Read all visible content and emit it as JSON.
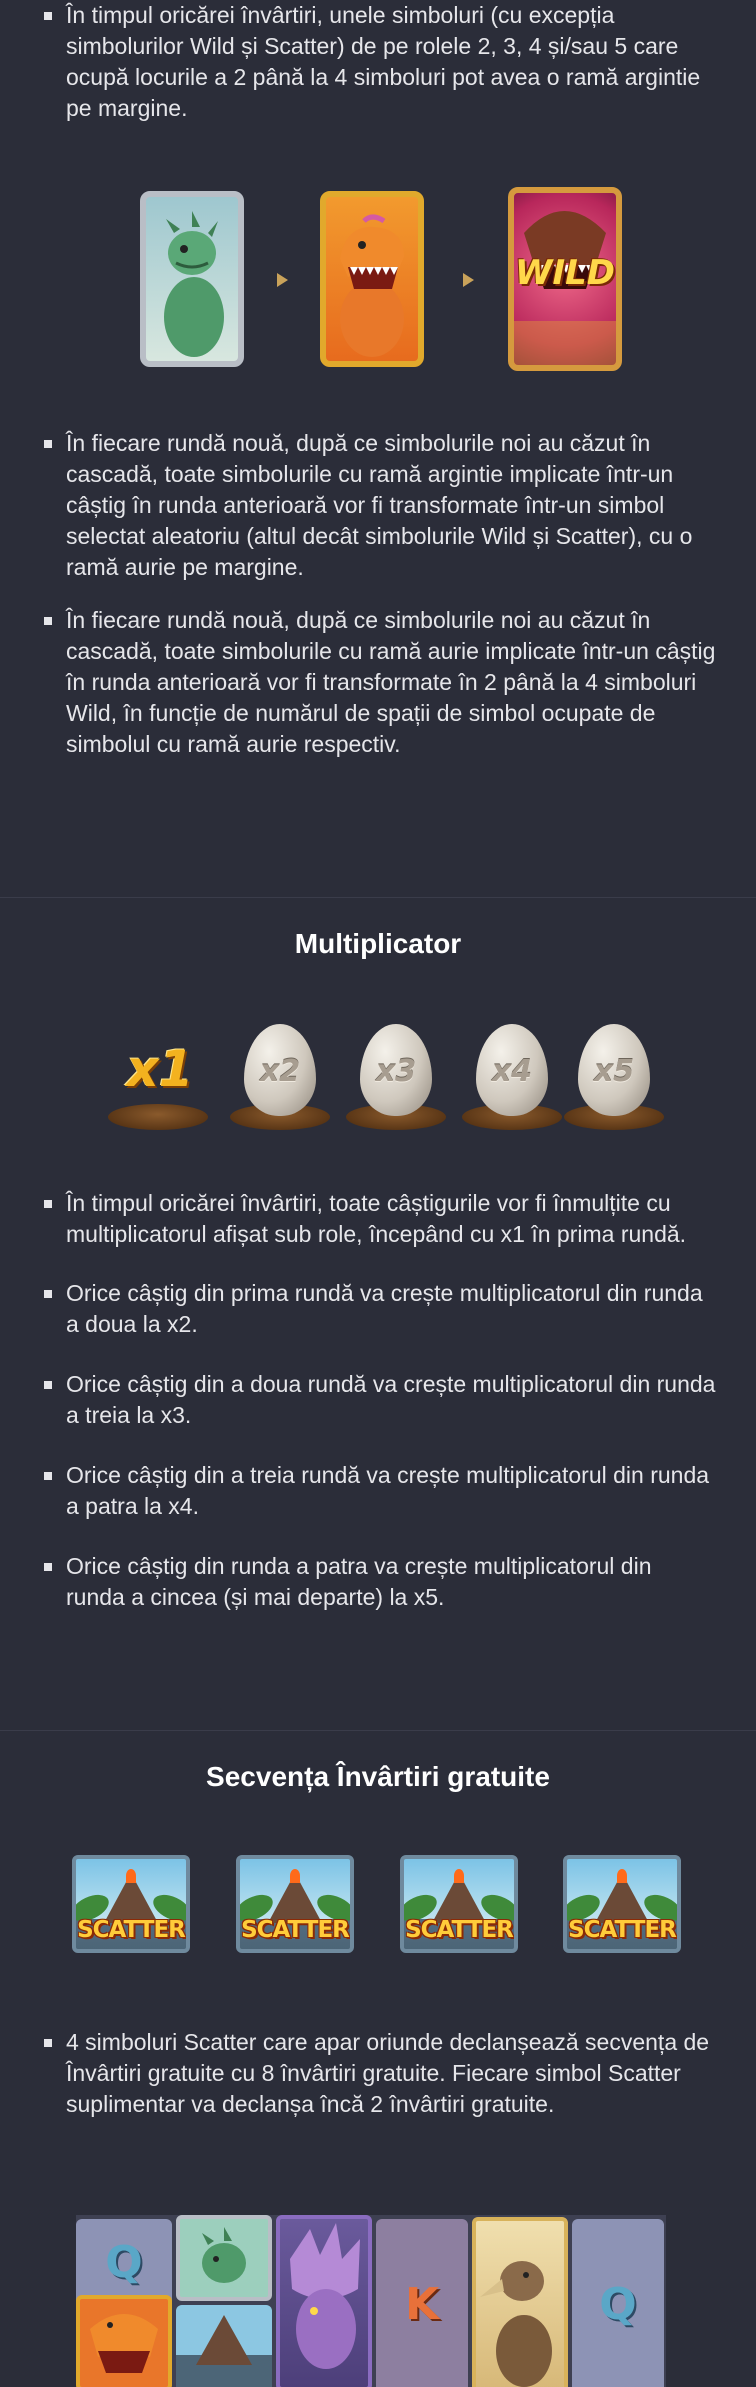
{
  "intro_bullets": [
    "În timpul oricărei învârtiri, unele simboluri (cu excepția simbolurilor Wild și Scatter) de pe rolele 2, 3, 4 și/sau 5 care ocupă locurile a 2 până la 4 simboluri pot avea o ramă argintie pe margine."
  ],
  "frame_progression": {
    "wild_text": "WILD"
  },
  "transform_bullets": [
    "În fiecare rundă nouă, după ce simbolurile noi au căzut în cascadă, toate simbolurile cu ramă argintie implicate într-un câștig în runda anterioară vor fi transformate într-un simbol selectat aleatoriu (altul decât simbolurile Wild și Scatter), cu o ramă aurie pe margine.",
    "În fiecare rundă nouă, după ce simbolurile noi au căzut în cascadă, toate simbolurile cu ramă aurie implicate într-un câștig în runda anterioară vor fi transformate în 2 până la 4 simboluri Wild, în funcție de numărul de spații de simbol ocupate de simbolul cu ramă aurie respectiv."
  ],
  "multiplier": {
    "heading": "Multiplicator",
    "eggs": [
      "x1",
      "x2",
      "x3",
      "x4",
      "x5"
    ],
    "bullets": [
      "În timpul oricărei învârtiri, toate câștigurile vor fi înmulțite cu multiplicatorul afișat sub role, începând cu x1 în prima rundă.",
      "Orice câștig din prima rundă va crește multiplicatorul din runda a doua la x2.",
      "Orice câștig din a doua rundă va crește multiplicatorul din runda a treia la x3.",
      "Orice câștig din a treia rundă va crește multiplicatorul din runda a patra la x4.",
      "Orice câștig din runda a patra va crește multiplicatorul din runda a cincea (și mai departe) la x5."
    ]
  },
  "free_spins": {
    "heading": "Secvența Învârtiri gratuite",
    "scatter_label": "SCATTER",
    "bullets": [
      "4 simboluri Scatter care apar oriunde declanșează secvența de Învârtiri gratuite cu 8 învârtiri gratuite. Fiecare simbol Scatter suplimentar va declanșa încă 2 învârtiri gratuite."
    ],
    "grid_letters": [
      "Q",
      "K",
      "Q"
    ]
  },
  "colors": {
    "background": "#2b2d39",
    "text": "#e6e6ea",
    "gold": "#f3b21f"
  }
}
